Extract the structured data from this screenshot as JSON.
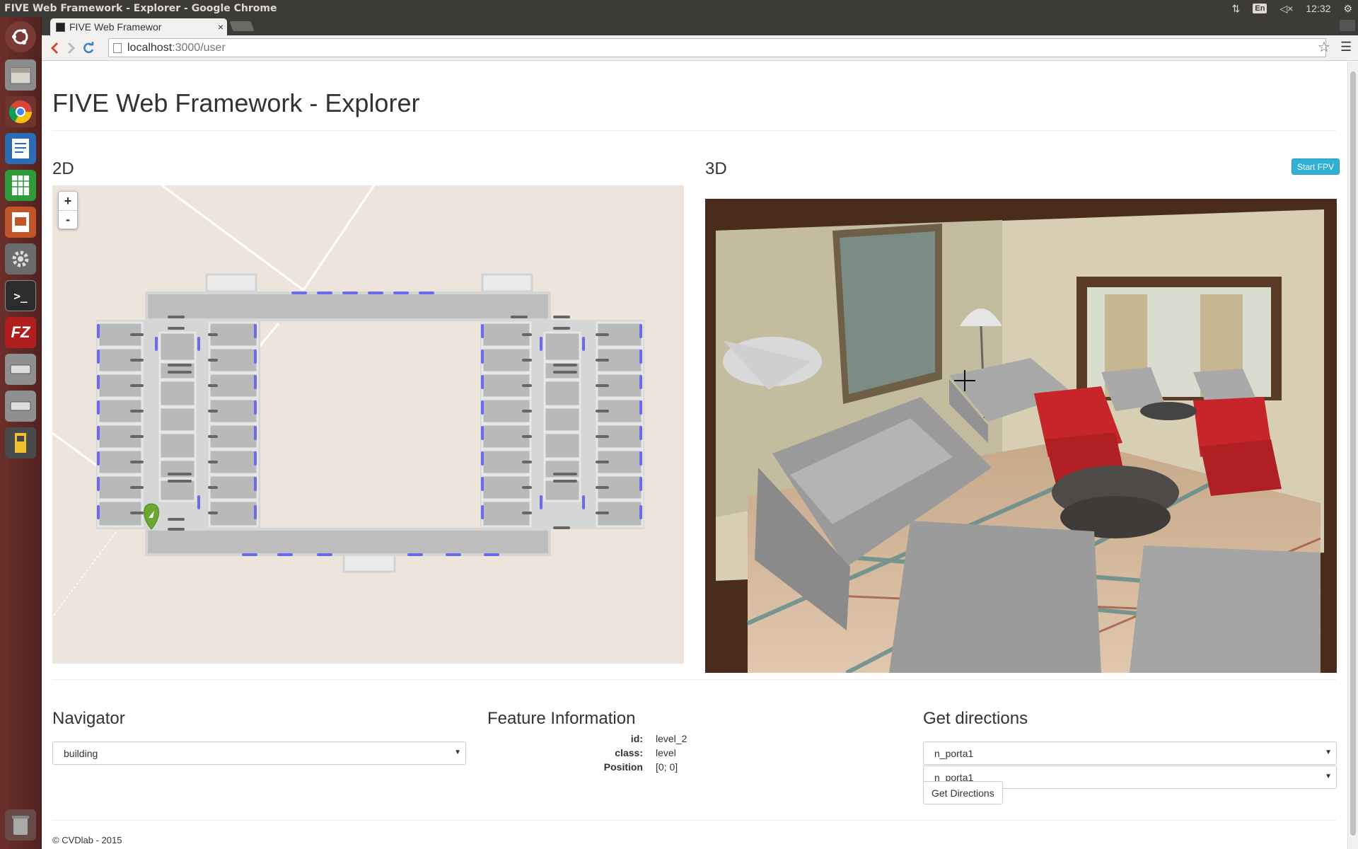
{
  "os": {
    "window_title": "FIVE Web Framework - Explorer - Google Chrome",
    "keyboard_layout": "En",
    "clock": "12:32",
    "tray_icons": [
      "network-arrows-icon",
      "keyboard-icon",
      "volume-muted-icon",
      "settings-gear-icon"
    ]
  },
  "launcher": {
    "items": [
      "ubuntu-dash-icon",
      "files-icon",
      "chrome-icon",
      "libreoffice-writer-icon",
      "libreoffice-calc-icon",
      "libreoffice-impress-icon",
      "system-settings-icon",
      "terminal-icon",
      "filezilla-icon",
      "drive-icon",
      "drive-icon",
      "usb-icon",
      "trash-icon"
    ],
    "filezilla_label": "FZ"
  },
  "browser": {
    "tab_title": "FIVE Web Framewor",
    "tab_close": "×",
    "url_host": "localhost",
    "url_path": ":3000/user"
  },
  "page": {
    "title": "FIVE Web Framework - Explorer",
    "section_2d": "2D",
    "section_3d": "3D",
    "start_fpv_label": "Start FPV",
    "zoom_in": "+",
    "zoom_out": "-",
    "navigator": {
      "heading": "Navigator",
      "selected": "building"
    },
    "feature_info": {
      "heading": "Feature Information",
      "rows": [
        {
          "key": "id:",
          "value": "level_2"
        },
        {
          "key": "class:",
          "value": "level"
        },
        {
          "key": "Position",
          "value": "[0; 0]"
        }
      ]
    },
    "directions": {
      "heading": "Get directions",
      "from_selected": "n_porta1",
      "to_selected": "n_porta1",
      "button_label": "Get Directions"
    },
    "footer": "© CVDlab - 2015"
  },
  "colors": {
    "map_bg": "#ede4db",
    "door_blue": "#6a6af0",
    "marker_green": "#6aa832",
    "fpv_button": "#31b0d5"
  }
}
